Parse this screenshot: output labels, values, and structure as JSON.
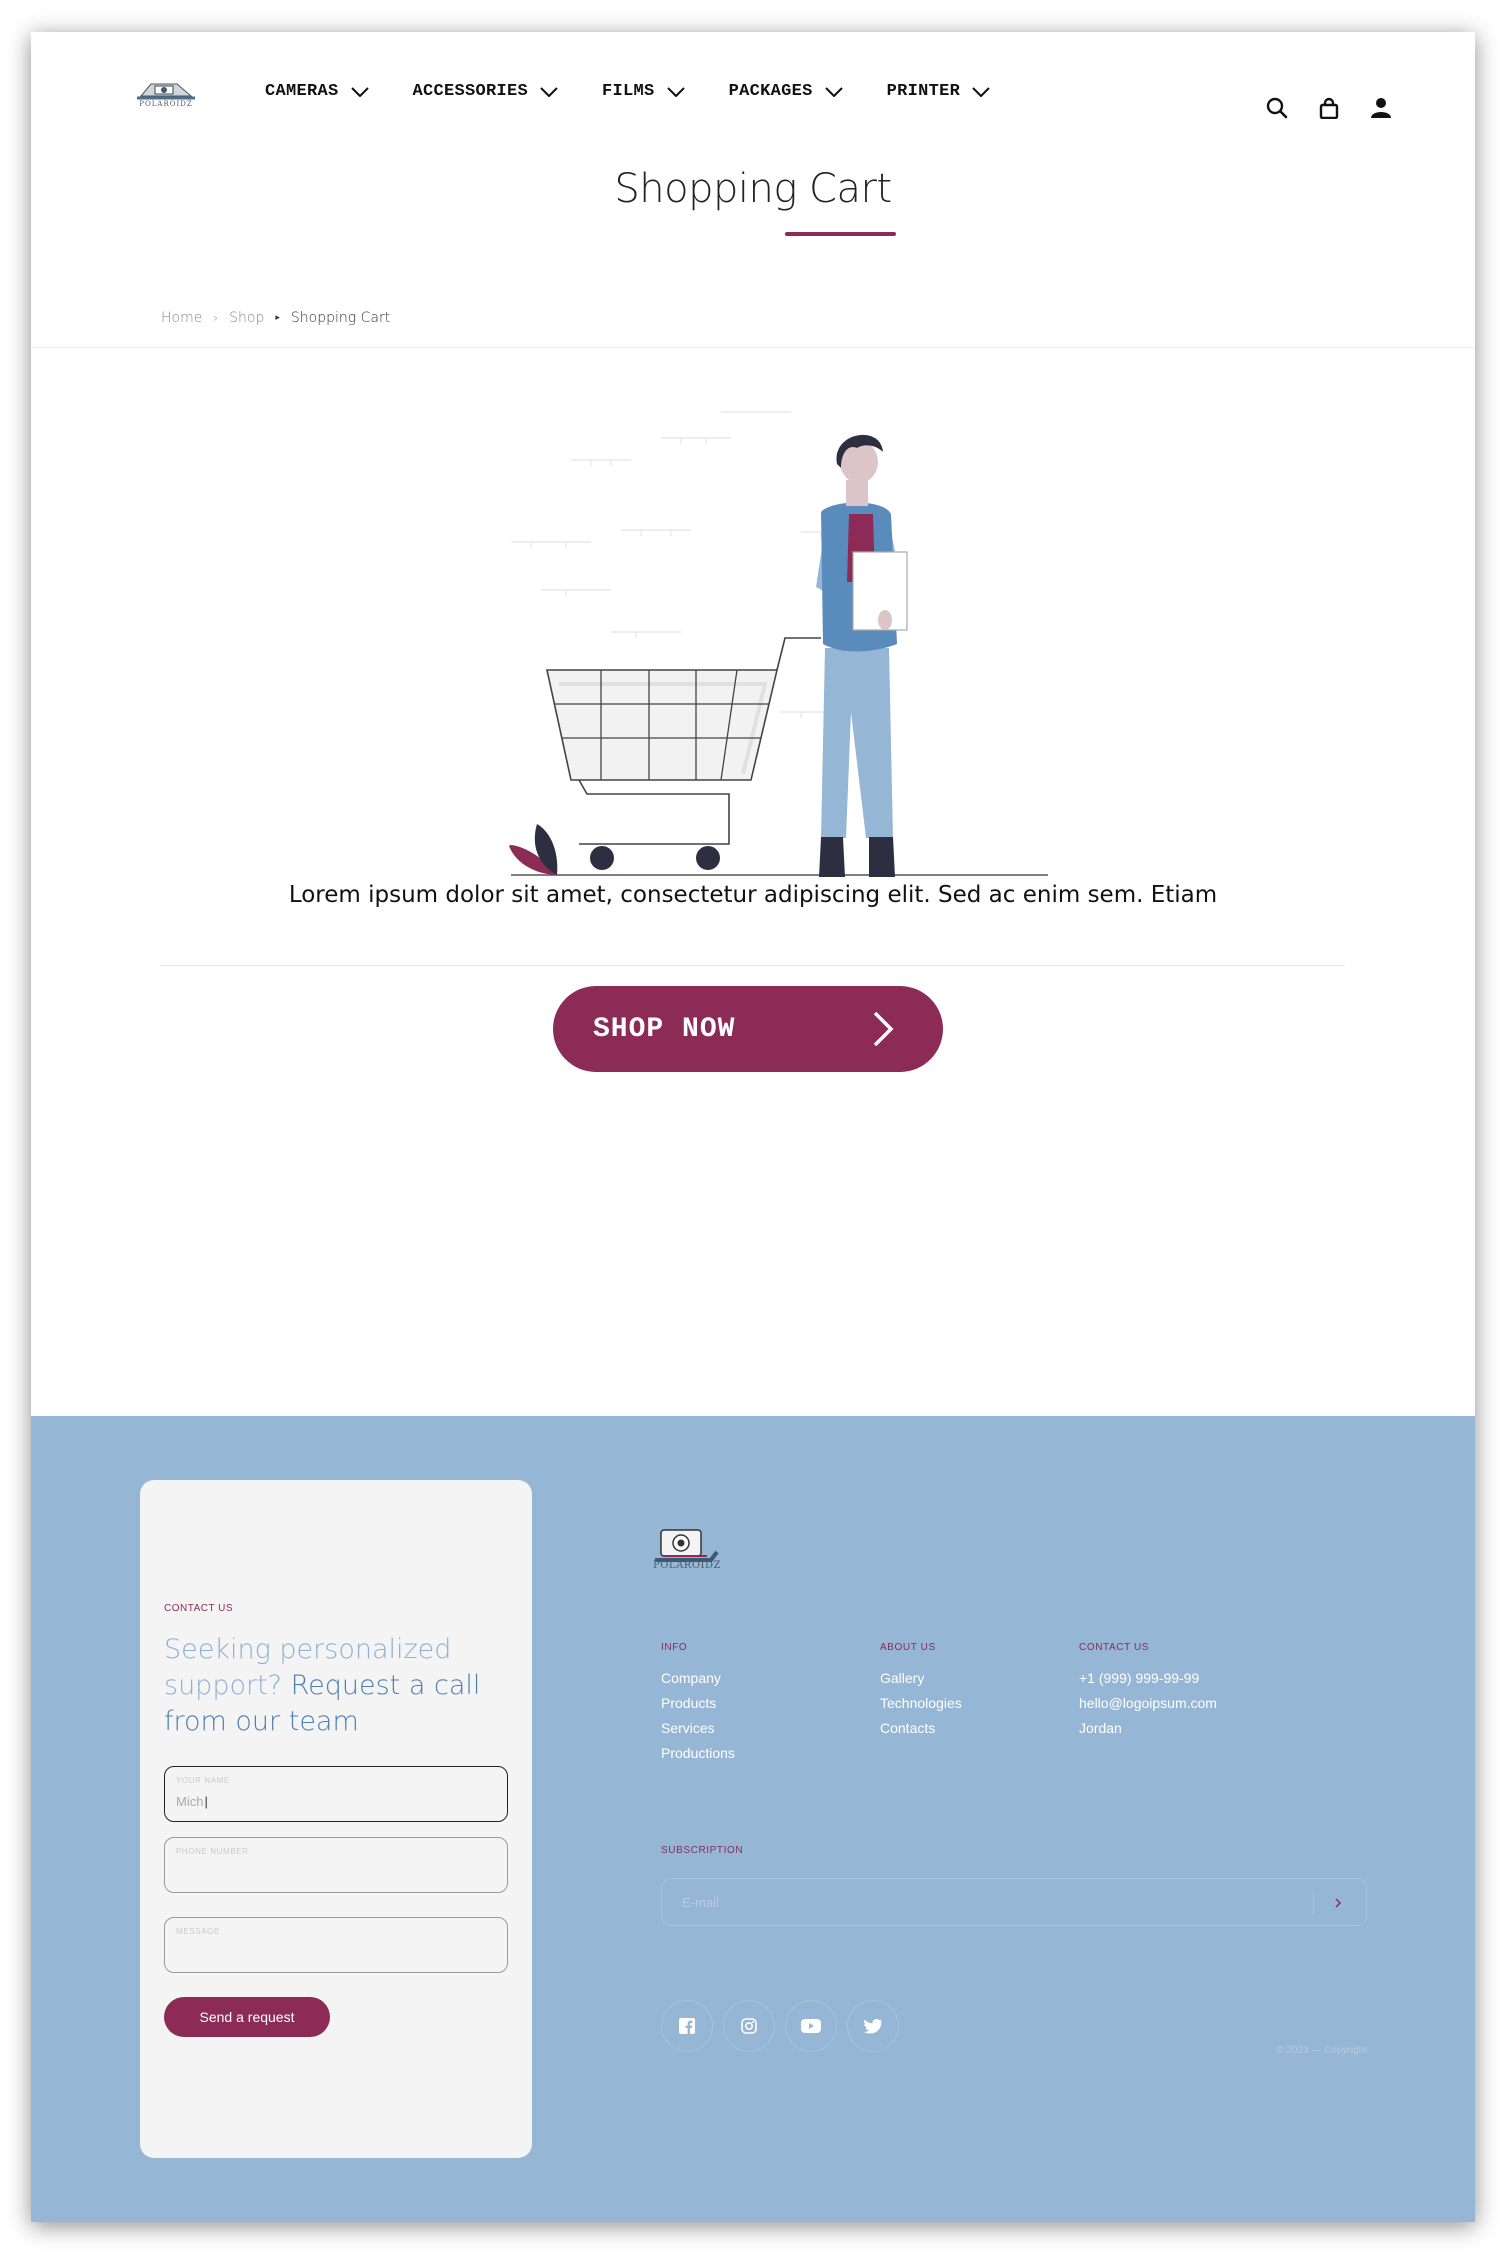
{
  "header": {
    "logo_text": "POLAROIDZ",
    "nav": [
      {
        "label": "CAMERAS"
      },
      {
        "label": "ACCESSORIES"
      },
      {
        "label": "FILMS"
      },
      {
        "label": "PACKAGES"
      },
      {
        "label": "PRINTER"
      }
    ],
    "icons": [
      "search-icon",
      "bag-icon",
      "user-icon"
    ]
  },
  "page": {
    "title": "Shopping Cart",
    "breadcrumb": {
      "home": "Home",
      "shop": "Shop",
      "current": "Shopping Cart"
    },
    "message": "Lorem ipsum dolor sit amet, consectetur adipiscing elit. Sed ac enim sem. Etiam",
    "shop_button": "SHOP NOW"
  },
  "contact_form": {
    "label": "CONTACT US",
    "heading_light": "Seeking personalized support?",
    "heading_dark": "Request a call from our team",
    "fields": [
      {
        "label": "YOUR NAME",
        "value": "Mich"
      },
      {
        "label": "PHONE NUMBER",
        "value": ""
      },
      {
        "label": "MESSAGE",
        "value": ""
      }
    ],
    "submit": "Send a request"
  },
  "footer": {
    "logo_text": "POLAROIDZ",
    "columns": [
      {
        "heading": "INFO",
        "links": [
          "Company",
          "Products",
          "Services",
          "Productions"
        ]
      },
      {
        "heading": "ABOUT US",
        "links": [
          "Gallery",
          "Technologies",
          "Contacts"
        ]
      },
      {
        "heading": "CONTACT US",
        "links": [
          "+1 (999) 999-99-99",
          "hello@logoipsum.com",
          "Jordan"
        ]
      }
    ],
    "subscription": {
      "heading": "SUBSCRIPTION",
      "placeholder": "E-mail"
    },
    "socials": [
      "facebook-icon",
      "instagram-icon",
      "youtube-icon",
      "twitter-icon"
    ],
    "copyright": "© 2023 — Copyright"
  },
  "colors": {
    "accent": "#8c2b55",
    "footer_bg": "#96b6d5",
    "figure_blue": "#5a8bbd"
  }
}
